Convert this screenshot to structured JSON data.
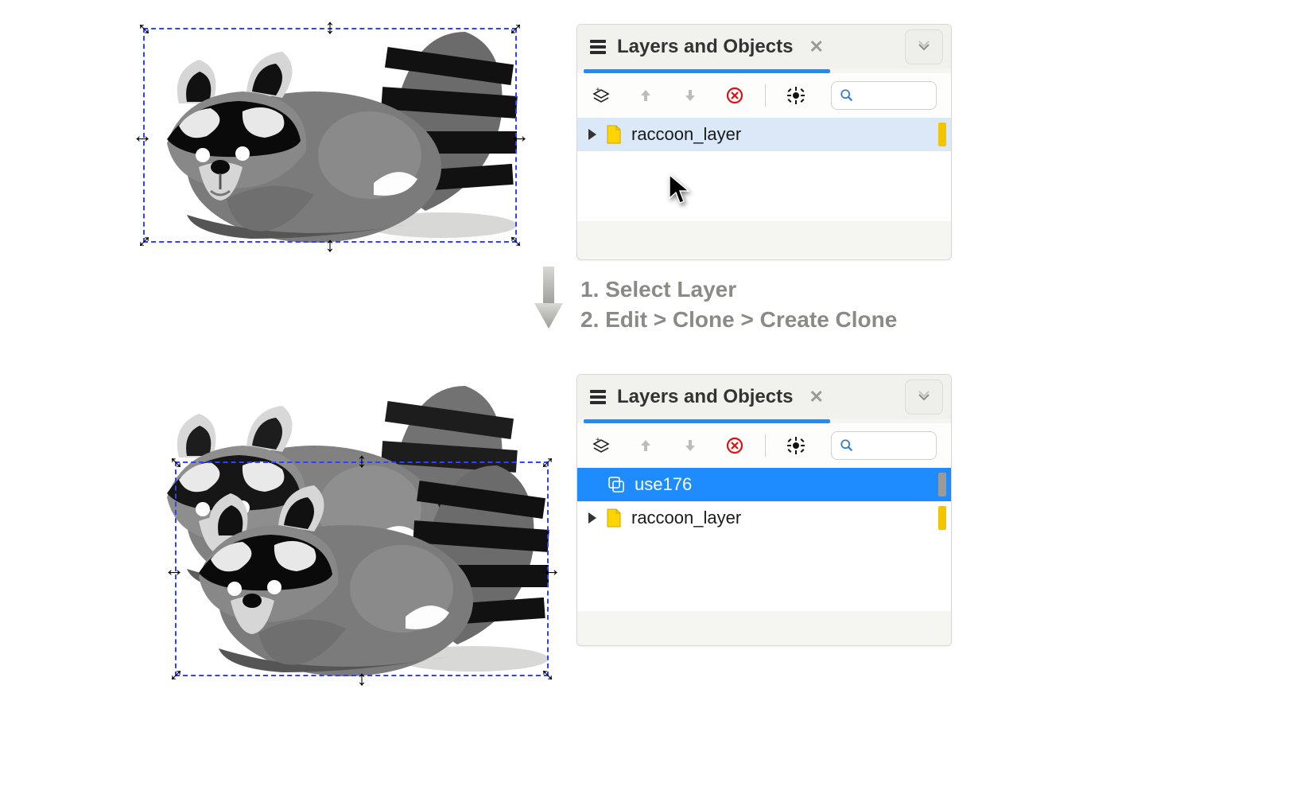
{
  "panel1": {
    "title": "Layers and Objects",
    "rows": [
      {
        "name": "raccoon_layer",
        "type": "layer",
        "endbar": "#f2c500"
      }
    ]
  },
  "panel2": {
    "title": "Layers and Objects",
    "rows": [
      {
        "name": "use176",
        "type": "clone",
        "endbar": "#9a9a96"
      },
      {
        "name": "raccoon_layer",
        "type": "layer",
        "endbar": "#f2c500"
      }
    ]
  },
  "instructions": {
    "line1": "1. Select Layer",
    "line2": "2. Edit > Clone  > Create Clone"
  }
}
